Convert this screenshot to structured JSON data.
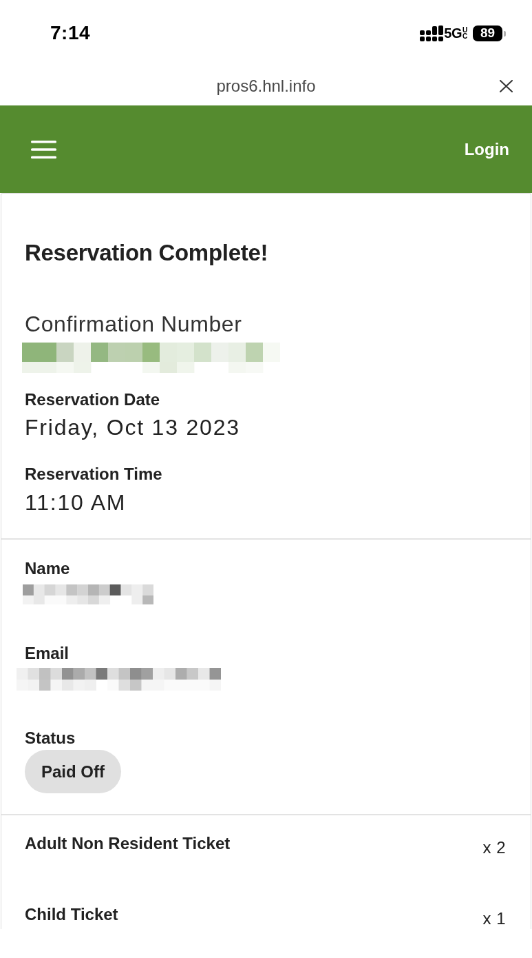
{
  "status_bar": {
    "time": "7:14",
    "network": "5G",
    "network_badge": "UC",
    "battery": "89"
  },
  "browser_bar": {
    "url": "pros6.hnl.info"
  },
  "app_bar": {
    "login": "Login"
  },
  "reservation": {
    "title": "Reservation Complete!",
    "confirmation_label": "Confirmation Number",
    "fields": [
      {
        "label": "Reservation Date",
        "value": "Friday, Oct 13 2023"
      },
      {
        "label": "Reservation Time",
        "value": "11:10 AM"
      }
    ]
  },
  "guest": {
    "fields": [
      {
        "label": "Name"
      },
      {
        "label": "Email"
      }
    ],
    "status_label": "Status",
    "status": "Paid Off"
  },
  "tickets": [
    {
      "name": "Adult Non Resident Ticket",
      "quantity": "x 2"
    },
    {
      "name": "Child Ticket",
      "quantity": "x 1"
    }
  ]
}
